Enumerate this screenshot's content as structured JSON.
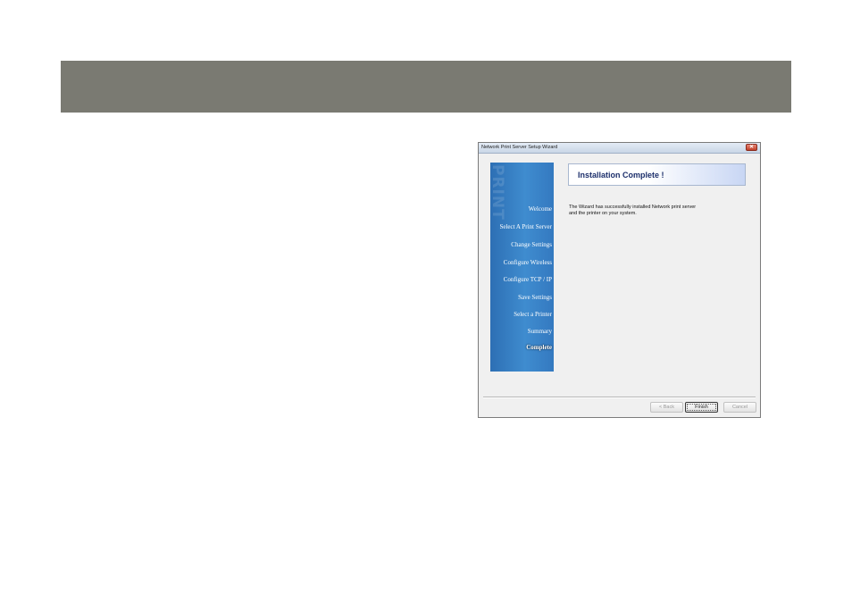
{
  "window": {
    "title": "Network Print Server Setup Wizard",
    "close_glyph": "✕"
  },
  "sidebar": {
    "watermark": "PRINT",
    "items": [
      {
        "label": "Welcome"
      },
      {
        "label": "Select A Print Server"
      },
      {
        "label": "Change Settings"
      },
      {
        "label": "Configure Wireless"
      },
      {
        "label": "Configure TCP / IP"
      },
      {
        "label": "Save Settings"
      },
      {
        "label": "Select a Printer"
      },
      {
        "label": "Summary"
      },
      {
        "label": "Complete",
        "current": true
      }
    ]
  },
  "main": {
    "heading": "Installation Complete !",
    "message_line1": "The Wizard has successfully installed Network print server",
    "message_line2": "and the printer on your system."
  },
  "buttons": {
    "back_label": "< Back",
    "finish_label": "Finish",
    "cancel_label": "Cancel"
  },
  "colors": {
    "banner": "#7a7a72",
    "sidebar_blue": "#3479c0",
    "heading_text": "#1c2f6b"
  }
}
